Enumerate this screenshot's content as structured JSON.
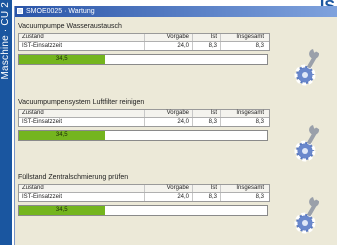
{
  "sidebar": {
    "text": "Maschine · CU 2"
  },
  "logo": {
    "text": "IS"
  },
  "window": {
    "title": "SMOE0025 · Wartung"
  },
  "columns": {
    "status": "Zustand",
    "target": "Vorgabe",
    "actual": "Ist",
    "total": "Insgesamt"
  },
  "sections": [
    {
      "title": "Vacuumpumpe Wasseraustausch",
      "row_label": "IST-Einsatzzeit",
      "target": "24,0",
      "actual": "8,3",
      "total": "8,3",
      "progress_label": "34,5",
      "progress_fraction": 0.345
    },
    {
      "title": "Vacuumpumpensystem Luftfilter reinigen",
      "row_label": "IST-Einsatzzeit",
      "target": "24,0",
      "actual": "8,3",
      "total": "8,3",
      "progress_label": "34,5",
      "progress_fraction": 0.345
    },
    {
      "title": "Füllstand Zentralschmierung prüfen",
      "row_label": "IST-Einsatzzeit",
      "target": "24,0",
      "actual": "8,3",
      "total": "8,3",
      "progress_label": "34,5",
      "progress_fraction": 0.345
    }
  ],
  "colors": {
    "accent_blue": "#1a56a0",
    "progress_green": "#74b51e",
    "gear_blue": "#5878c0"
  },
  "icons": {
    "sidebar": "machine-label",
    "maintenance": "gear-wrench-icon"
  }
}
